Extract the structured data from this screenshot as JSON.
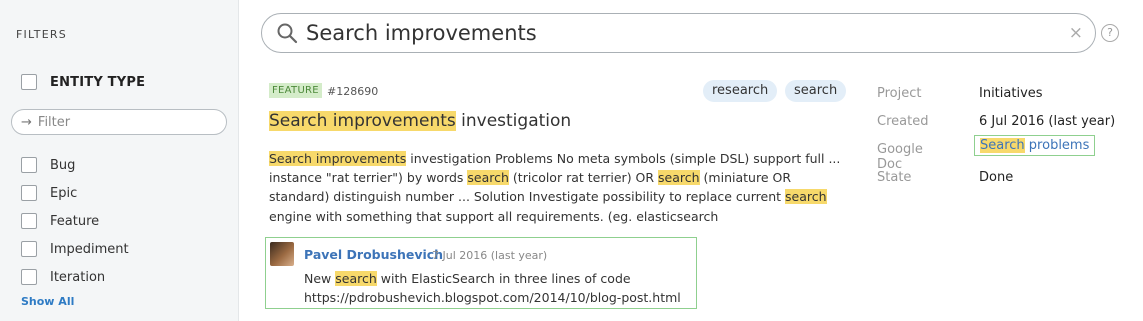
{
  "sidebar": {
    "title": "FILTERS",
    "entity_type_label": "ENTITY TYPE",
    "filter_placeholder": "Filter",
    "types": [
      "Bug",
      "Epic",
      "Feature",
      "Impediment",
      "Iteration"
    ],
    "show_all": "Show All"
  },
  "search": {
    "query": "Search improvements",
    "clear_symbol": "×",
    "help_symbol": "?"
  },
  "result": {
    "entity_type": "FEATURE",
    "id": "#128690",
    "tags": [
      "research",
      "search"
    ],
    "title_hl": "Search improvements",
    "title_rest": " investigation",
    "snippet": [
      {
        "t": "Search improvements",
        "hl": true
      },
      {
        "t": " investigation Problems No meta symbols (simple DSL) support full ... instance \"rat terrier\") by words ",
        "hl": false
      },
      {
        "t": "search",
        "hl": true
      },
      {
        "t": " (tricolor rat terrier) OR ",
        "hl": false
      },
      {
        "t": "search",
        "hl": true
      },
      {
        "t": " (miniature OR standard) distinguish number ... Solution Investigate possibility to replace current ",
        "hl": false
      },
      {
        "t": "search",
        "hl": true
      },
      {
        "t": " engine with something that support all requirements. (eg. elasticsearch",
        "hl": false
      }
    ],
    "comment": {
      "author": "Pavel Drobushevich",
      "date": "7 Jul 2016",
      "date_relative": "(last year)",
      "line1_pre": "New ",
      "line1_hl": "search",
      "line1_post": " with ElasticSearch in three lines of code",
      "line2": "https://pdrobushevich.blogspot.com/2014/10/blog-post.html"
    },
    "properties": {
      "project_label": "Project",
      "project_value": "Initiatives",
      "created_label": "Created",
      "created_value": "6 Jul 2016 (last year)",
      "google_doc_label": "Google Doc",
      "google_doc_hl": "Search",
      "google_doc_rest": " problems",
      "state_label": "State",
      "state_value": "Done"
    }
  },
  "colors": {
    "highlight": "#f7d96b",
    "link": "#3d74b8",
    "badge_bg": "#d4ecc9",
    "tag_bg": "#e3eef8",
    "match_border": "#8fd08f"
  }
}
